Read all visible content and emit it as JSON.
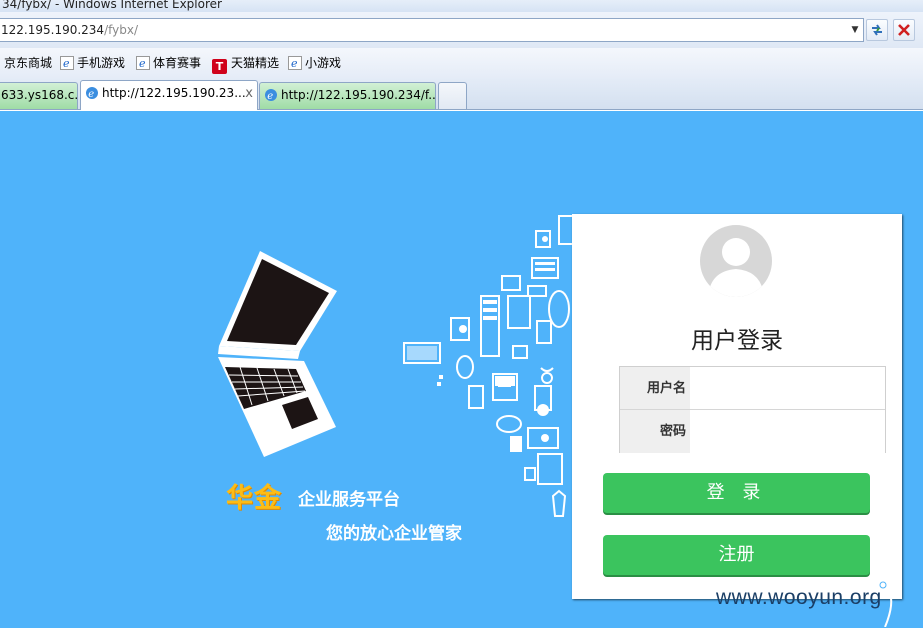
{
  "browser": {
    "window_title": "34/fybx/ - Windows Internet Explorer",
    "address": {
      "host": "122.195.190.234",
      "path": "/fybx/"
    },
    "favorites": [
      {
        "label": "京东商城",
        "icon": "ie-icon"
      },
      {
        "label": "手机游戏",
        "icon": "ie-icon"
      },
      {
        "label": "体育赛事",
        "icon": "ie-icon"
      },
      {
        "label": "天猫精选",
        "icon": "tmall-icon"
      },
      {
        "label": "小游戏",
        "icon": "ie-icon"
      }
    ],
    "tabs": [
      {
        "label": "633.ys168.c...",
        "state": "inactive"
      },
      {
        "label": "http://122.195.190.23...",
        "state": "active"
      },
      {
        "label": "http://122.195.190.234/f...",
        "state": "inactive"
      }
    ],
    "tab_close": "x",
    "tmall_glyph": "T"
  },
  "page": {
    "brand": {
      "name": "华金",
      "tagline": "企业服务平台",
      "slogan": "您的放心企业管家"
    },
    "login": {
      "title": "用户登录",
      "username_label": "用户名",
      "password_label": "密码",
      "username_value": "",
      "password_value": "",
      "login_button": "登 录",
      "register_button": "注册"
    },
    "watermark": "www.wooyun.org"
  },
  "colors": {
    "page_background": "#4fb3fa",
    "button_green": "#3bc45e",
    "brand_orange": "#fcbc16"
  }
}
